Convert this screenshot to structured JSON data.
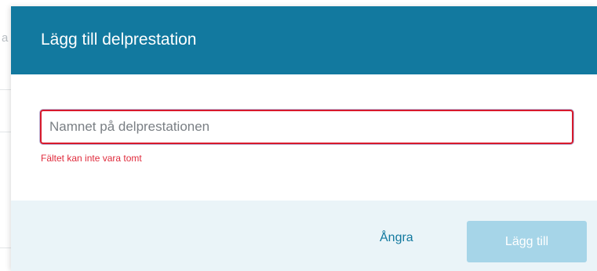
{
  "background": {
    "hint_text": "a"
  },
  "dialog": {
    "title": "Lägg till delprestation",
    "name_input": {
      "value": "",
      "placeholder": "Namnet på delprestationen"
    },
    "error_message": "Fältet kan inte vara tomt",
    "cancel_label": "Ångra",
    "add_label": "Lägg till",
    "add_enabled": false
  },
  "colors": {
    "header_bg": "#12799f",
    "error": "#e02b3c",
    "footer_bg": "#eaf4f8",
    "primary_disabled": "#a6d5e8",
    "link": "#12799f"
  }
}
